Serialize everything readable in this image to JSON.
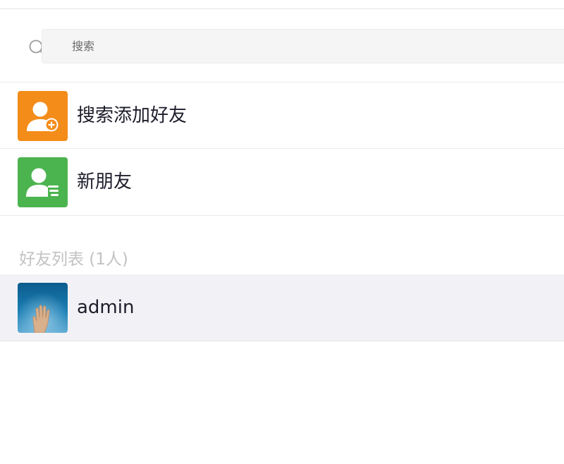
{
  "search": {
    "placeholder": "搜索"
  },
  "actions": [
    {
      "label": "搜索添加好友",
      "icon": "add-friend-icon",
      "color": "#f48c1a"
    },
    {
      "label": "新朋友",
      "icon": "new-friend-icon",
      "color": "#4cb44f"
    }
  ],
  "friends_section": {
    "title": "好友列表 (1人)",
    "items": [
      {
        "name": "admin",
        "avatar": "hand-photo-avatar"
      }
    ]
  }
}
